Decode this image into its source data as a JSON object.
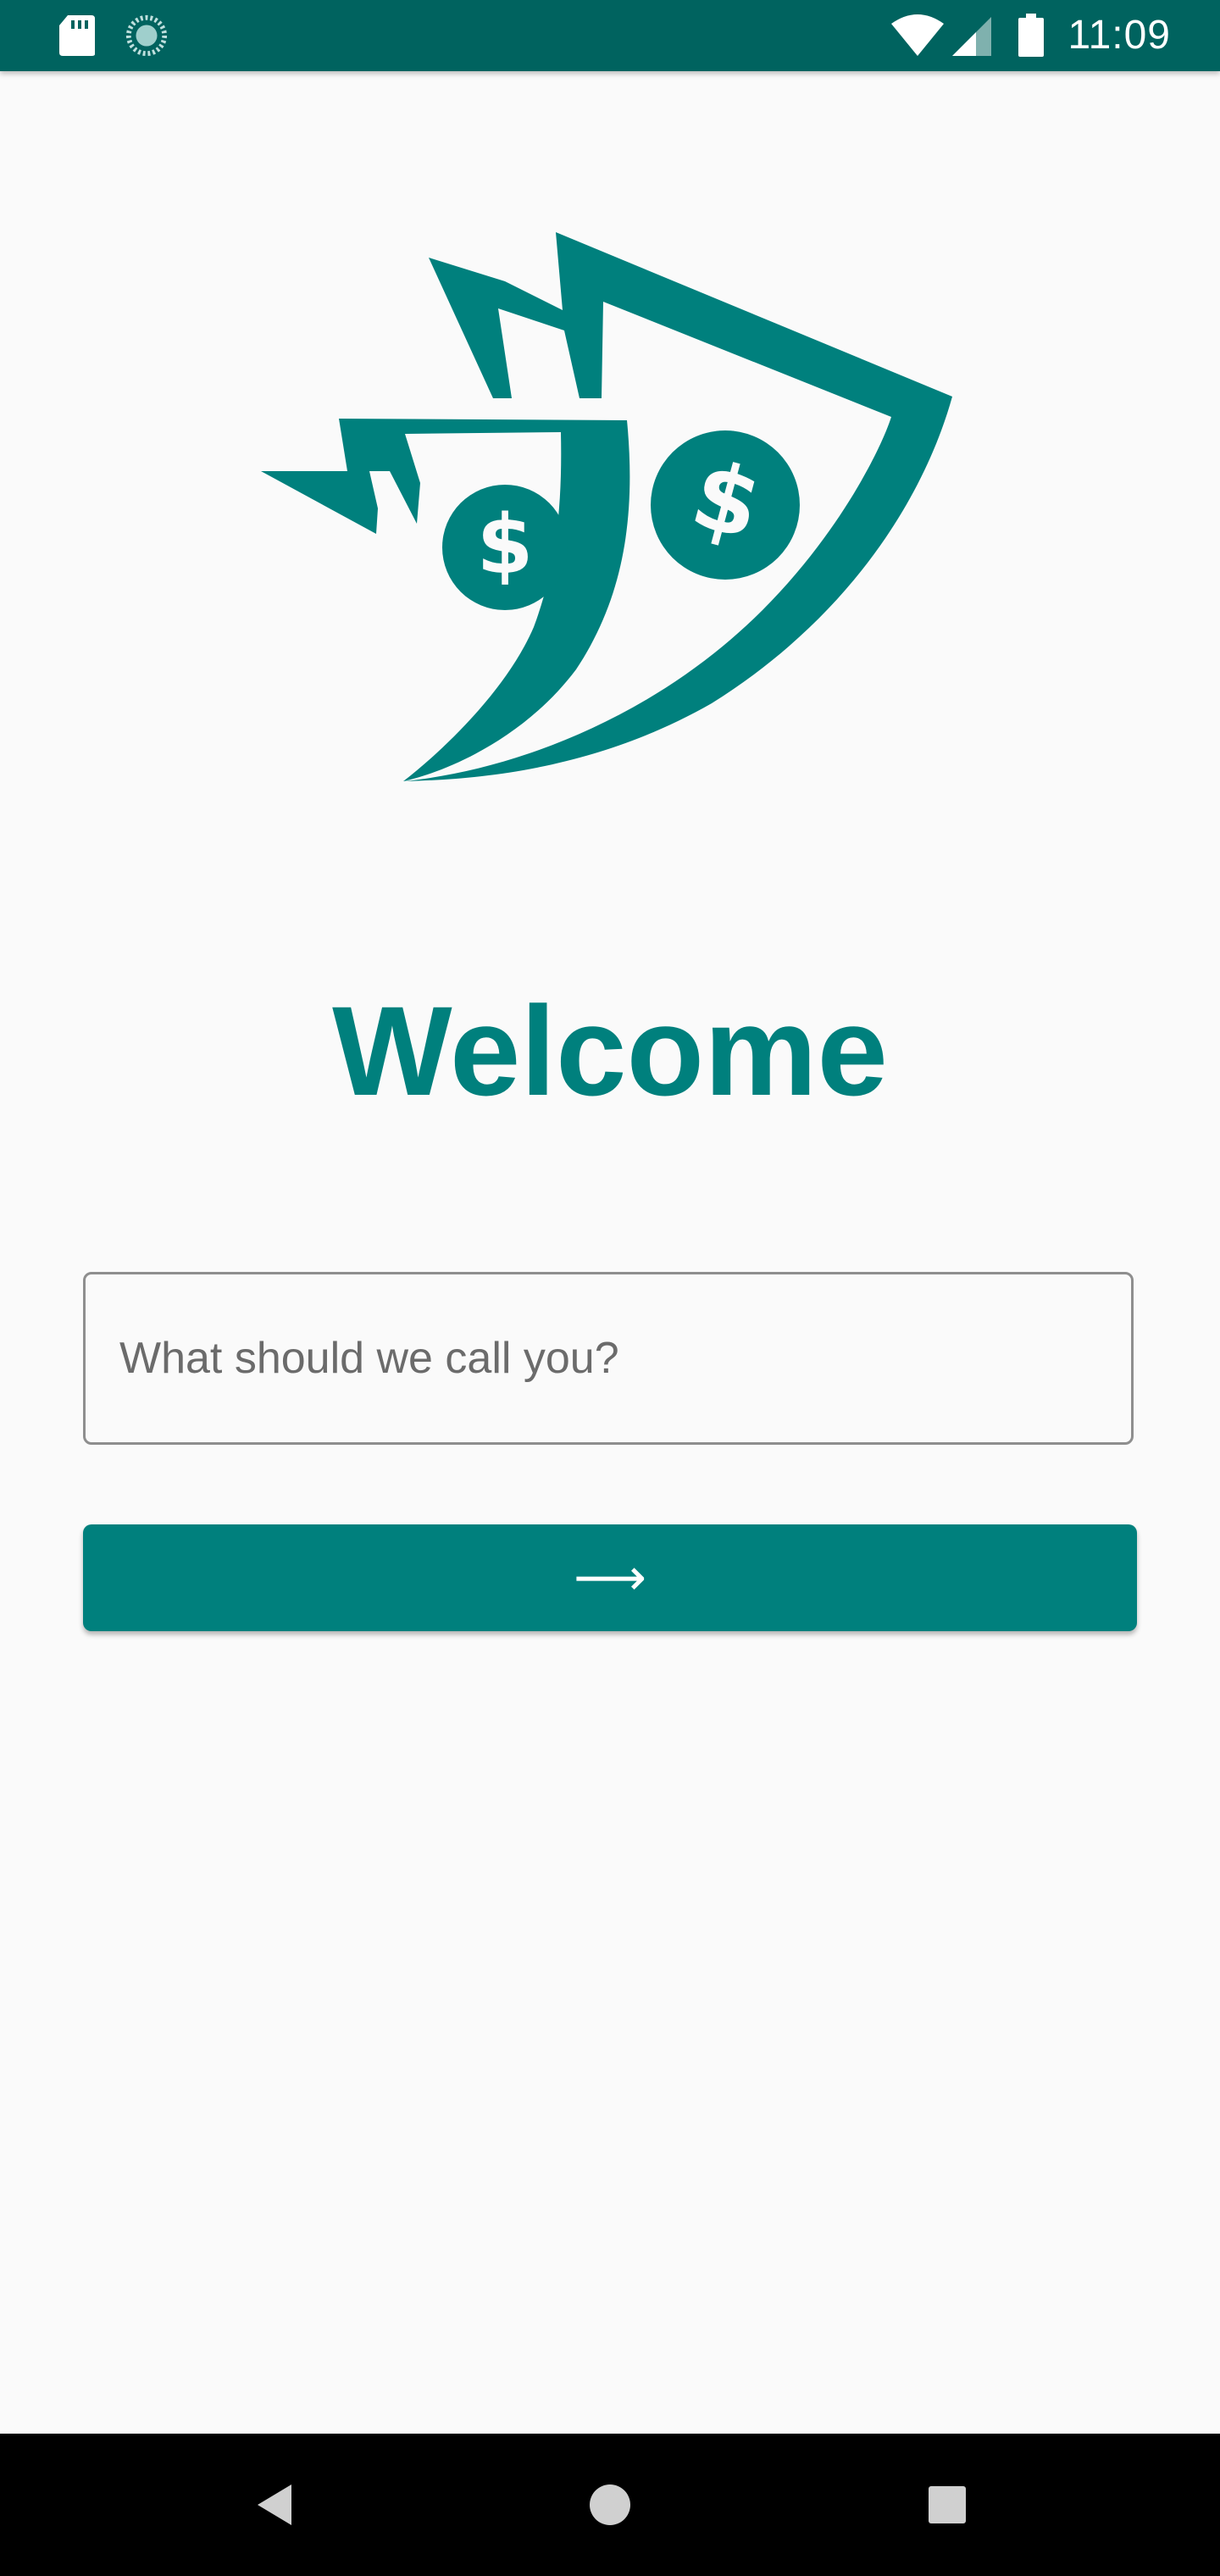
{
  "status_bar": {
    "time": "11:09",
    "icons": [
      "sd-card-icon",
      "loading-icon",
      "wifi-icon",
      "signal-icon",
      "battery-icon"
    ]
  },
  "logo": {
    "name": "money-bills-logo",
    "color": "#00807d"
  },
  "welcome": {
    "title": "Welcome"
  },
  "name_input": {
    "placeholder": "What should we call you?",
    "value": ""
  },
  "next_button": {
    "label": "⟶",
    "icon": "arrow-right-icon"
  },
  "nav_bar": {
    "buttons": [
      "back-icon",
      "home-icon",
      "recents-icon"
    ]
  },
  "colors": {
    "accent": "#00807d",
    "status_bar": "#00635f",
    "background": "#fafafa"
  }
}
